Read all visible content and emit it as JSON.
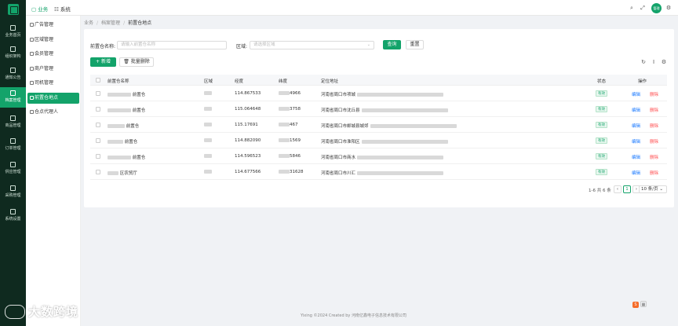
{
  "colors": {
    "accent": "#13a36a",
    "rail_bg": "#0f2a1f",
    "link": "#1677ff",
    "danger": "#ff4d4f"
  },
  "rail": {
    "items": [
      {
        "label": "业务首页",
        "icon": "home-icon"
      },
      {
        "label": "组织架构",
        "icon": "org-icon"
      },
      {
        "label": "通知公告",
        "icon": "bell-icon"
      },
      {
        "label": "档案管理",
        "icon": "archive-icon"
      },
      {
        "label": "商品管理",
        "icon": "goods-icon"
      },
      {
        "label": "订单管理",
        "icon": "order-icon"
      },
      {
        "label": "供应管理",
        "icon": "supply-icon"
      },
      {
        "label": "采购管理",
        "icon": "purchase-icon"
      },
      {
        "label": "系统设置",
        "icon": "settings-icon"
      }
    ]
  },
  "topbar": {
    "nav": [
      "业务",
      "系统"
    ],
    "avatar_text": "管理"
  },
  "submenu": {
    "items": [
      "广告管理",
      "区域管理",
      "会员管理",
      "商户管理",
      "司机管理",
      "前置仓地点",
      "仓点代理人"
    ],
    "active_index": 5
  },
  "breadcrumb": [
    "业务",
    "档案管理",
    "前置仓地点"
  ],
  "filters": {
    "name_label": "前置仓名称:",
    "name_placeholder": "请输入前置仓名称",
    "area_label": "区域:",
    "area_placeholder": "请选择区域",
    "search_btn": "查询",
    "reset_btn": "重置"
  },
  "toolbar": {
    "add_btn": "+ 新增",
    "batch_delete_btn": "批量删除"
  },
  "table": {
    "headers": [
      "前置仓名称",
      "区域",
      "经度",
      "纬度",
      "定位地址",
      "状态",
      "操作"
    ],
    "rows": [
      {
        "name": "前置仓",
        "lng": "114.867533",
        "lat": "4966",
        "addr": "河南省周口市项城",
        "status": "有效"
      },
      {
        "name": "前置仓",
        "lng": "115.064648",
        "lat": "3758",
        "addr": "河南省周口市沈丘县",
        "status": "有效"
      },
      {
        "name": "前置仓",
        "lng": "115.17691",
        "lat": "467",
        "addr": "河南省周口市郸城县城郊",
        "status": "有效"
      },
      {
        "name": "前置仓",
        "lng": "114.882090",
        "lat": "1569",
        "addr": "河南省周口市淮阳区",
        "status": "有效"
      },
      {
        "name": "前置仓",
        "lng": "114.596523",
        "lat": "5846",
        "addr": "河南省周口市商水",
        "status": "有效"
      },
      {
        "name": "区农贸厅",
        "lng": "114.677566",
        "lat": "31628",
        "addr": "河南省周口市川汇",
        "status": "有效"
      }
    ],
    "edit": "编辑",
    "delete": "删除"
  },
  "pagination": {
    "summary": "1-6 共 6 条",
    "page": "1",
    "page_size": "10 条/页"
  },
  "footer": "Yixing ©2024 Created by 河南亿鑫电子信息技术有限公司",
  "watermark": "大数跨境"
}
